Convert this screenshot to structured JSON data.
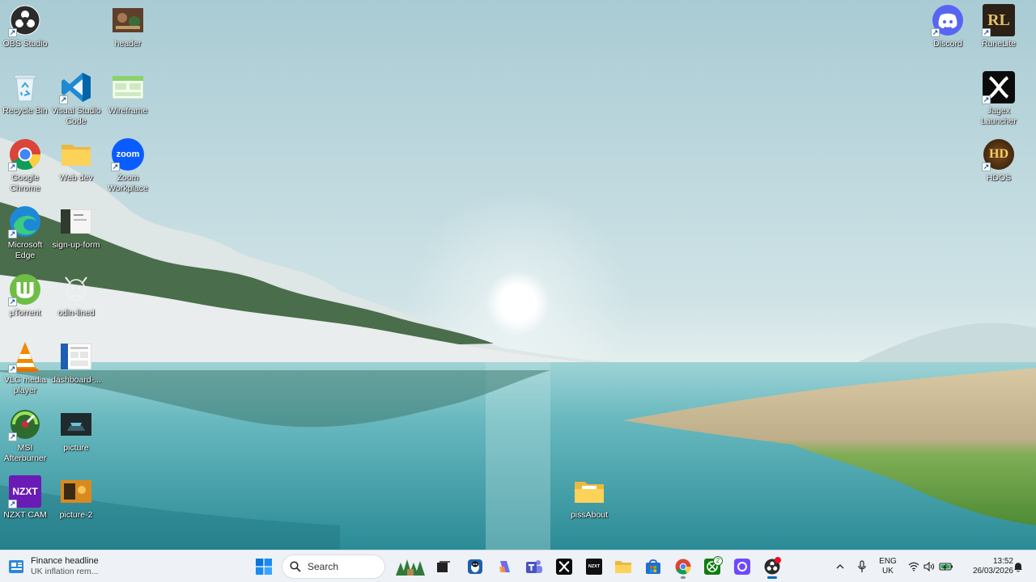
{
  "desktop": {
    "icons": [
      {
        "label": "OBS Studio",
        "icon": "obs-icon"
      },
      {
        "label": "header",
        "icon": "image-file-icon"
      },
      {
        "label": "Recycle Bin",
        "icon": "recycle-bin-icon"
      },
      {
        "label": "Visual Studio Code",
        "icon": "vscode-icon"
      },
      {
        "label": "Wireframe",
        "icon": "image-file-icon"
      },
      {
        "label": "Google Chrome",
        "icon": "chrome-icon"
      },
      {
        "label": "Web dev",
        "icon": "folder-icon"
      },
      {
        "label": "Zoom Workplace",
        "icon": "zoom-icon"
      },
      {
        "label": "Microsoft Edge",
        "icon": "edge-icon"
      },
      {
        "label": "sign-up-form",
        "icon": "image-file-icon"
      },
      {
        "label": "µTorrent",
        "icon": "utorrent-icon"
      },
      {
        "label": "odin-lined",
        "icon": "image-file-icon"
      },
      {
        "label": "VLC media player",
        "icon": "vlc-icon"
      },
      {
        "label": "dashboard-...",
        "icon": "image-file-icon"
      },
      {
        "label": "MSI Afterburner",
        "icon": "afterburner-icon"
      },
      {
        "label": "picture",
        "icon": "image-file-icon"
      },
      {
        "label": "NZXT CAM",
        "icon": "nzxt-icon"
      },
      {
        "label": "picture-2",
        "icon": "image-file-icon"
      },
      {
        "label": "pissAbout",
        "icon": "folder-icon"
      },
      {
        "label": "Discord",
        "icon": "discord-icon"
      },
      {
        "label": "RuneLite",
        "icon": "runelite-icon"
      },
      {
        "label": "Jagex Launcher",
        "icon": "jagex-icon"
      },
      {
        "label": "HDOS",
        "icon": "hdos-icon"
      }
    ],
    "zoom_text": "zoom",
    "nzxt_text": "NZXT",
    "runelite_text": "RL",
    "hdos_text": "HD"
  },
  "taskbar": {
    "news": {
      "title": "Finance headline",
      "subtitle": "UK inflation rem..."
    },
    "search_placeholder": "Search",
    "apps": [
      "start-icon",
      "widgets-icon",
      "task-view-icon",
      "penguin-app-icon",
      "copilot-icon",
      "teams-icon",
      "jagex-icon",
      "nzxt-icon",
      "file-explorer-icon",
      "store-icon",
      "chrome-icon",
      "xbox-icon",
      "proton-icon",
      "obs-icon"
    ],
    "xbox_badge": "2",
    "nzxt_small": "NZXT",
    "tray": {
      "language": "ENG",
      "region": "UK",
      "time": "13:52",
      "date": "26/03/2026"
    }
  },
  "colors": {
    "accent": "#0067c0",
    "taskbar_bg": "#eef1f5"
  }
}
